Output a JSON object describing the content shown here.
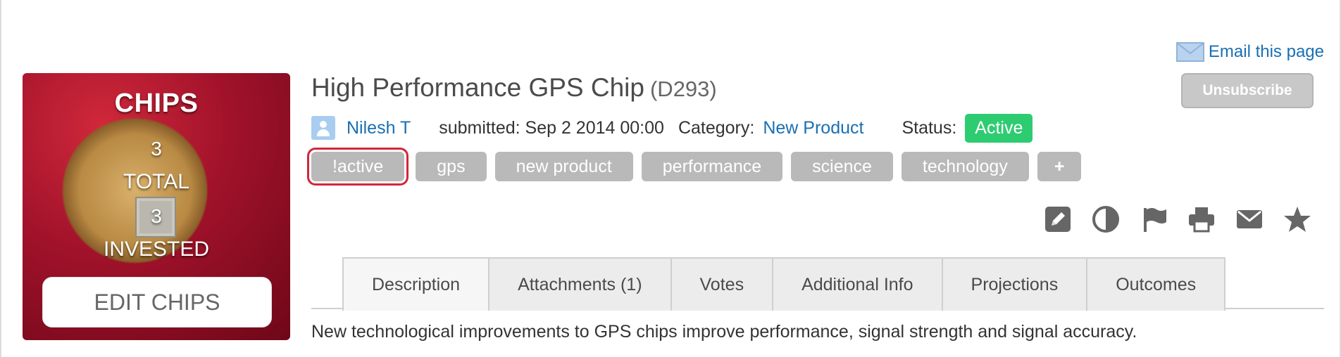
{
  "chips": {
    "title": "CHIPS",
    "total": "3",
    "total_label": "TOTAL",
    "invested": "3",
    "invested_label": "INVESTED",
    "edit_button": "EDIT CHIPS"
  },
  "email_link": "Email this page",
  "unsubscribe_label": "Unsubscribe",
  "idea": {
    "title": "High Performance GPS Chip",
    "id": "(D293)",
    "author": "Nilesh T",
    "submitted": "submitted: Sep 2 2014 00:00",
    "category_label": "Category:",
    "category": "New Product",
    "status_label": "Status:",
    "status": "Active"
  },
  "tags": [
    "!active",
    "gps",
    "new product",
    "performance",
    "science",
    "technology"
  ],
  "add_tag_label": "+",
  "actions": [
    "edit-icon",
    "contrast-icon",
    "flag-icon",
    "print-icon",
    "envelope-icon",
    "star-icon"
  ],
  "tabs": [
    "Description",
    "Attachments (1)",
    "Votes",
    "Additional Info",
    "Projections",
    "Outcomes"
  ],
  "active_tab": "Description",
  "description": "New technological improvements to GPS chips improve performance, signal strength and signal accuracy.",
  "colors": {
    "link": "#1a6fb3",
    "status_active": "#2ecc71",
    "tag_bg": "#b9b9b9",
    "selected_outline": "#d3263a",
    "card_red": "#a0122a"
  }
}
